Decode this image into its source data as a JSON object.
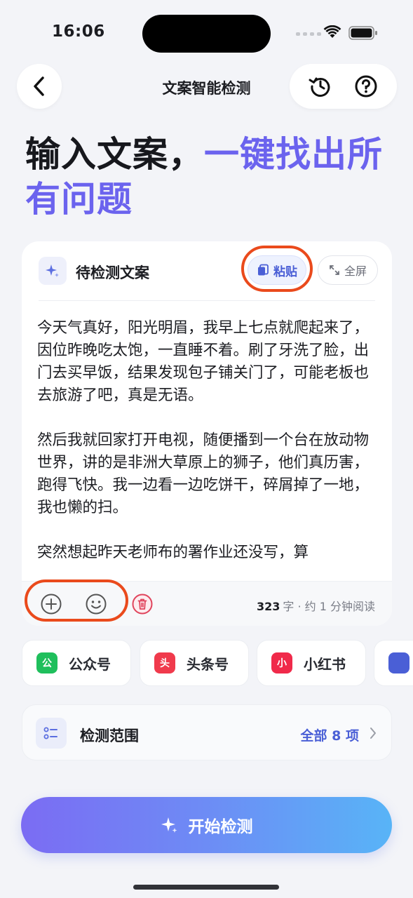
{
  "status_bar": {
    "time": "16:06"
  },
  "nav": {
    "title": "文案智能检测",
    "back_icon": "chevron-left-icon",
    "history_icon": "history-icon",
    "help_icon": "help-circle-icon"
  },
  "headline": {
    "part1": "输入文案，",
    "part2": "一键找出所有问题"
  },
  "editor": {
    "title": "待检测文案",
    "paste_label": "粘贴",
    "fullscreen_label": "全屏",
    "paragraphs": [
      "今天气真好，阳光明眉，我早上七点就爬起来了，因位昨晚吃太饱，一直睡不着。刷了牙洗了脸，出门去买早饭，结果发现包子铺关门了，可能老板也去旅游了吧，真是无语。",
      "然后我就回家打开电视，随便播到一个台在放动物世界，讲的是非洲大草原上的狮子，他们真历害，跑得飞快。我一边看一边吃饼干，碎屑掉了一地，我也懒的扫。",
      "突然想起昨天老师布的署作业还没写，算"
    ],
    "word_count": "323",
    "word_unit": "字 · 约 1 分钟阅读"
  },
  "platforms": [
    {
      "label": "公众号",
      "badge": "公",
      "color": "#1fbf5c"
    },
    {
      "label": "头条号",
      "badge": "头",
      "color": "#f03a4c"
    },
    {
      "label": "小红书",
      "badge": "小",
      "color": "#f02a4a"
    },
    {
      "label": "",
      "badge": "",
      "color": "#4a5fd6"
    }
  ],
  "scope": {
    "label": "检测范围",
    "value": "全部 8 项"
  },
  "start_button": {
    "label": "开始检测"
  }
}
